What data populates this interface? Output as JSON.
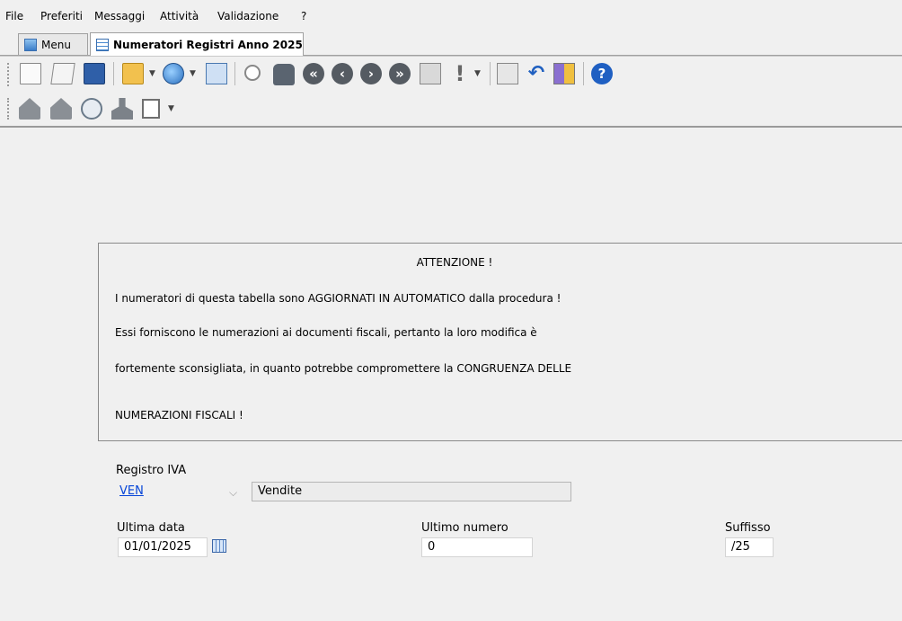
{
  "menu": {
    "items": [
      "File",
      "Preferiti",
      "Messaggi",
      "Attività",
      "Validazione",
      "?"
    ]
  },
  "tabs": [
    {
      "label": "Menu"
    },
    {
      "label": "Numeratori Registri Anno 2025"
    }
  ],
  "toolbar1": {
    "icons": [
      "new-document-icon",
      "copy-document-icon",
      "save-icon",
      "open-folder-icon",
      "globe-icon",
      "sheet-settings-icon",
      "search-icon",
      "binoculars-icon",
      "first-record-icon",
      "previous-record-icon",
      "next-record-icon",
      "last-record-icon",
      "clipboard-icon",
      "exclamation-icon",
      "envelope-icon",
      "undo-icon",
      "gift-icon",
      "help-icon"
    ]
  },
  "toolbar2": {
    "icons": [
      "house-icon",
      "house-alt-icon",
      "compass-icon",
      "person-icon",
      "form-icon"
    ]
  },
  "notice": {
    "title": "ATTENZIONE !",
    "lines": [
      "I numeratori di questa tabella sono AGGIORNATI IN AUTOMATICO dalla procedura !",
      "Essi forniscono le numerazioni ai documenti fiscali, pertanto la loro modifica è",
      "fortemente sconsigliata, in quanto potrebbe compromettere la CONGRUENZA DELLE",
      "NUMERAZIONI FISCALI !"
    ]
  },
  "form": {
    "registro_label": "Registro IVA",
    "registro_code": "VEN",
    "registro_desc": "Vendite",
    "ultima_data_label": "Ultima data",
    "ultima_data_value": "01/01/2025",
    "ultimo_numero_label": "Ultimo numero",
    "ultimo_numero_value": "0",
    "suffisso_label": "Suffisso",
    "suffisso_value": "/25"
  }
}
